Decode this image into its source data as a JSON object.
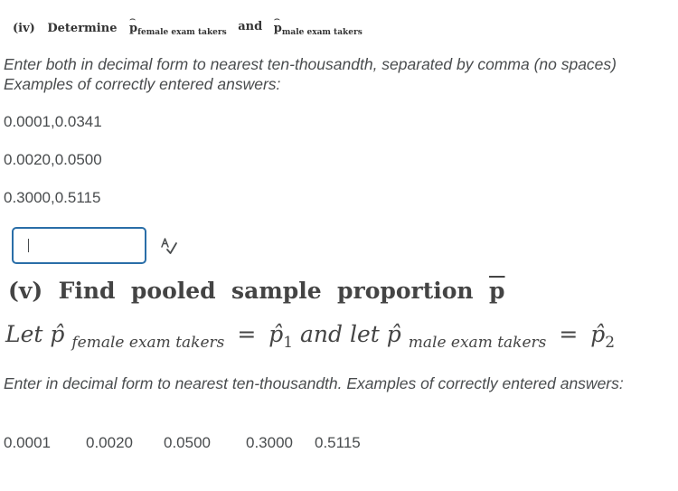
{
  "part_iv": {
    "label": "(iv)",
    "determine": "Determine",
    "p_symbol": "p",
    "sub_female": "female exam takers",
    "and": "and",
    "sub_male": "male exam takers"
  },
  "instructions_iv": "Enter both in decimal form to nearest ten-thousandth, separated by comma (no spaces)  Examples of correctly entered answers:",
  "examples_iv": [
    "0.0001,0.0341",
    "0.0020,0.0500",
    "0.3000,0.5115"
  ],
  "answer_input": {
    "value": ""
  },
  "spellcheck_icon": "spellcheck-icon",
  "part_v": {
    "label": "(v)",
    "title": "Find  pooled  sample  proportion",
    "symbol": "p"
  },
  "let_line": {
    "let1": "Let",
    "p_hat": "p̂",
    "sub_female": "female exam takers",
    "eq1": "=",
    "p1": "p̂",
    "p1_sub": "1",
    "and_let": "and let",
    "sub_male": "male exam takers",
    "eq2": "=",
    "p2": "p̂",
    "p2_sub": "2"
  },
  "instructions_v": "Enter in decimal form to nearest ten-thousandth.  Examples of correctly entered answers:",
  "examples_v": [
    "0.0001",
    "0.0020",
    "0.0500",
    "0.3000",
    "0.5115"
  ],
  "colors": {
    "text": "#494c4e",
    "input_border": "#2a6ea8"
  }
}
